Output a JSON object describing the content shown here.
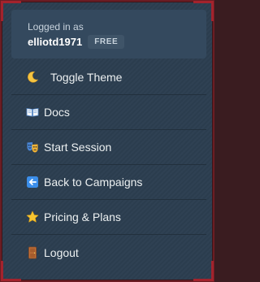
{
  "account": {
    "logged_in_label": "Logged in as",
    "username": "elliotd1971",
    "plan": "FREE"
  },
  "menu": [
    {
      "label": "Toggle Theme",
      "icon": "crescent-moon-icon"
    },
    {
      "label": "Docs",
      "icon": "open-book-icon"
    },
    {
      "label": "Start Session",
      "icon": "theater-masks-icon"
    },
    {
      "label": "Back to Campaigns",
      "icon": "left-arrow-icon"
    },
    {
      "label": "Pricing & Plans",
      "icon": "star-icon"
    },
    {
      "label": "Logout",
      "icon": "door-icon"
    }
  ],
  "colors": {
    "panel_background": "#2c3e50",
    "header_background": "#34495e",
    "frame_border": "#6b1d23",
    "text": "#ecf0f1"
  }
}
